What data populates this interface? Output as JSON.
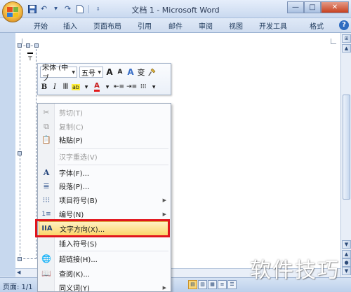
{
  "window": {
    "title": "文档 1 - Microsoft Word"
  },
  "qat": {
    "undo": "↶",
    "redo": "↷"
  },
  "ribbon": {
    "tabs": [
      "开始",
      "插入",
      "页面布局",
      "引用",
      "邮件",
      "审阅",
      "视图",
      "开发工具",
      "格式"
    ],
    "help": "?"
  },
  "minibar": {
    "font": "宋体 (中ブ",
    "size": "五号",
    "grow": "A",
    "shrink": "A",
    "style": "A",
    "phonetic": "变",
    "bold": "B",
    "italic": "I"
  },
  "context_menu": {
    "items": [
      {
        "label": "剪切(T)",
        "icon": "scissors-icon",
        "disabled": true
      },
      {
        "label": "复制(C)",
        "icon": "copy-icon",
        "disabled": true
      },
      {
        "label": "粘贴(P)",
        "icon": "paste-icon",
        "disabled": false
      },
      {
        "label": "汉字重选(V)",
        "icon": "",
        "disabled": true
      },
      {
        "label": "字体(F)...",
        "icon": "font-icon",
        "disabled": false
      },
      {
        "label": "段落(P)...",
        "icon": "paragraph-icon",
        "disabled": false
      },
      {
        "label": "项目符号(B)",
        "icon": "bullets-icon",
        "disabled": false,
        "submenu": true
      },
      {
        "label": "编号(N)",
        "icon": "numbering-icon",
        "disabled": false,
        "submenu": true
      },
      {
        "label": "文字方向(X)...",
        "icon": "text-direction-icon",
        "disabled": false,
        "highlighted": true
      },
      {
        "label": "插入符号(S)",
        "icon": "",
        "disabled": false
      },
      {
        "label": "超链接(H)...",
        "icon": "hyperlink-icon",
        "disabled": false
      },
      {
        "label": "查阅(K)...",
        "icon": "lookup-icon",
        "disabled": false
      },
      {
        "label": "同义词(Y)",
        "icon": "",
        "disabled": false,
        "submenu": true
      }
    ]
  },
  "status": {
    "page": "页面: 1/1"
  },
  "watermark": "软件技巧",
  "colors": {
    "highlight_frame": "#e1141c",
    "menu_hover": "#fcd56a"
  }
}
